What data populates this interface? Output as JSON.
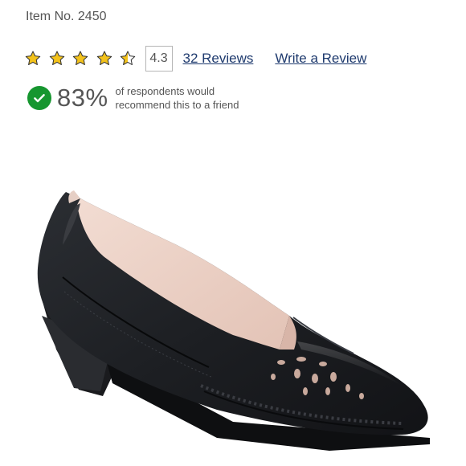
{
  "product": {
    "item_number": "Item No. 2450"
  },
  "rating": {
    "stars": 4.3,
    "max_stars": 5,
    "score_label": "4.3",
    "reviews_link": "32 Reviews",
    "write_review_link": "Write a Review",
    "star_color": "#f3c21b"
  },
  "recommendation": {
    "percent_label": "83%",
    "line1": "of respondents would",
    "line2": "recommend this to a friend",
    "check_color": "#16962f"
  },
  "image": {
    "icon": "shoe-image"
  }
}
